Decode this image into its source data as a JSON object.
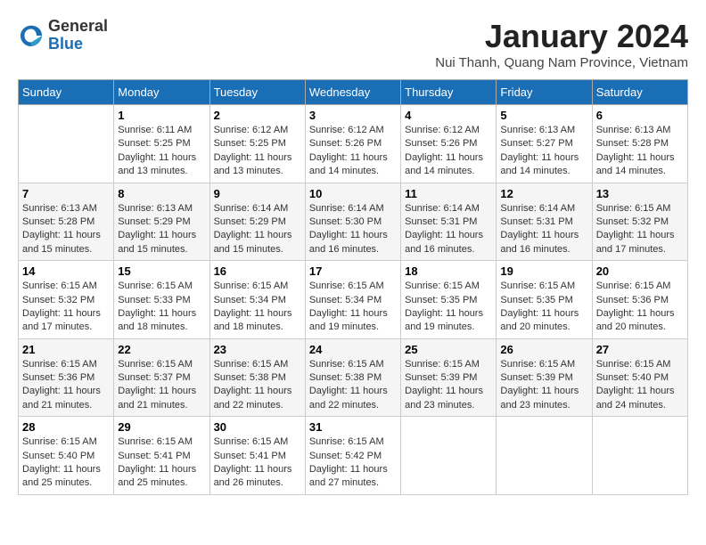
{
  "header": {
    "logo_general": "General",
    "logo_blue": "Blue",
    "month": "January 2024",
    "location": "Nui Thanh, Quang Nam Province, Vietnam"
  },
  "days_of_week": [
    "Sunday",
    "Monday",
    "Tuesday",
    "Wednesday",
    "Thursday",
    "Friday",
    "Saturday"
  ],
  "weeks": [
    [
      {
        "day": "",
        "info": ""
      },
      {
        "day": "1",
        "info": "Sunrise: 6:11 AM\nSunset: 5:25 PM\nDaylight: 11 hours\nand 13 minutes."
      },
      {
        "day": "2",
        "info": "Sunrise: 6:12 AM\nSunset: 5:25 PM\nDaylight: 11 hours\nand 13 minutes."
      },
      {
        "day": "3",
        "info": "Sunrise: 6:12 AM\nSunset: 5:26 PM\nDaylight: 11 hours\nand 14 minutes."
      },
      {
        "day": "4",
        "info": "Sunrise: 6:12 AM\nSunset: 5:26 PM\nDaylight: 11 hours\nand 14 minutes."
      },
      {
        "day": "5",
        "info": "Sunrise: 6:13 AM\nSunset: 5:27 PM\nDaylight: 11 hours\nand 14 minutes."
      },
      {
        "day": "6",
        "info": "Sunrise: 6:13 AM\nSunset: 5:28 PM\nDaylight: 11 hours\nand 14 minutes."
      }
    ],
    [
      {
        "day": "7",
        "info": "Sunrise: 6:13 AM\nSunset: 5:28 PM\nDaylight: 11 hours\nand 15 minutes."
      },
      {
        "day": "8",
        "info": "Sunrise: 6:13 AM\nSunset: 5:29 PM\nDaylight: 11 hours\nand 15 minutes."
      },
      {
        "day": "9",
        "info": "Sunrise: 6:14 AM\nSunset: 5:29 PM\nDaylight: 11 hours\nand 15 minutes."
      },
      {
        "day": "10",
        "info": "Sunrise: 6:14 AM\nSunset: 5:30 PM\nDaylight: 11 hours\nand 16 minutes."
      },
      {
        "day": "11",
        "info": "Sunrise: 6:14 AM\nSunset: 5:31 PM\nDaylight: 11 hours\nand 16 minutes."
      },
      {
        "day": "12",
        "info": "Sunrise: 6:14 AM\nSunset: 5:31 PM\nDaylight: 11 hours\nand 16 minutes."
      },
      {
        "day": "13",
        "info": "Sunrise: 6:15 AM\nSunset: 5:32 PM\nDaylight: 11 hours\nand 17 minutes."
      }
    ],
    [
      {
        "day": "14",
        "info": "Sunrise: 6:15 AM\nSunset: 5:32 PM\nDaylight: 11 hours\nand 17 minutes."
      },
      {
        "day": "15",
        "info": "Sunrise: 6:15 AM\nSunset: 5:33 PM\nDaylight: 11 hours\nand 18 minutes."
      },
      {
        "day": "16",
        "info": "Sunrise: 6:15 AM\nSunset: 5:34 PM\nDaylight: 11 hours\nand 18 minutes."
      },
      {
        "day": "17",
        "info": "Sunrise: 6:15 AM\nSunset: 5:34 PM\nDaylight: 11 hours\nand 19 minutes."
      },
      {
        "day": "18",
        "info": "Sunrise: 6:15 AM\nSunset: 5:35 PM\nDaylight: 11 hours\nand 19 minutes."
      },
      {
        "day": "19",
        "info": "Sunrise: 6:15 AM\nSunset: 5:35 PM\nDaylight: 11 hours\nand 20 minutes."
      },
      {
        "day": "20",
        "info": "Sunrise: 6:15 AM\nSunset: 5:36 PM\nDaylight: 11 hours\nand 20 minutes."
      }
    ],
    [
      {
        "day": "21",
        "info": "Sunrise: 6:15 AM\nSunset: 5:36 PM\nDaylight: 11 hours\nand 21 minutes."
      },
      {
        "day": "22",
        "info": "Sunrise: 6:15 AM\nSunset: 5:37 PM\nDaylight: 11 hours\nand 21 minutes."
      },
      {
        "day": "23",
        "info": "Sunrise: 6:15 AM\nSunset: 5:38 PM\nDaylight: 11 hours\nand 22 minutes."
      },
      {
        "day": "24",
        "info": "Sunrise: 6:15 AM\nSunset: 5:38 PM\nDaylight: 11 hours\nand 22 minutes."
      },
      {
        "day": "25",
        "info": "Sunrise: 6:15 AM\nSunset: 5:39 PM\nDaylight: 11 hours\nand 23 minutes."
      },
      {
        "day": "26",
        "info": "Sunrise: 6:15 AM\nSunset: 5:39 PM\nDaylight: 11 hours\nand 23 minutes."
      },
      {
        "day": "27",
        "info": "Sunrise: 6:15 AM\nSunset: 5:40 PM\nDaylight: 11 hours\nand 24 minutes."
      }
    ],
    [
      {
        "day": "28",
        "info": "Sunrise: 6:15 AM\nSunset: 5:40 PM\nDaylight: 11 hours\nand 25 minutes."
      },
      {
        "day": "29",
        "info": "Sunrise: 6:15 AM\nSunset: 5:41 PM\nDaylight: 11 hours\nand 25 minutes."
      },
      {
        "day": "30",
        "info": "Sunrise: 6:15 AM\nSunset: 5:41 PM\nDaylight: 11 hours\nand 26 minutes."
      },
      {
        "day": "31",
        "info": "Sunrise: 6:15 AM\nSunset: 5:42 PM\nDaylight: 11 hours\nand 27 minutes."
      },
      {
        "day": "",
        "info": ""
      },
      {
        "day": "",
        "info": ""
      },
      {
        "day": "",
        "info": ""
      }
    ]
  ]
}
